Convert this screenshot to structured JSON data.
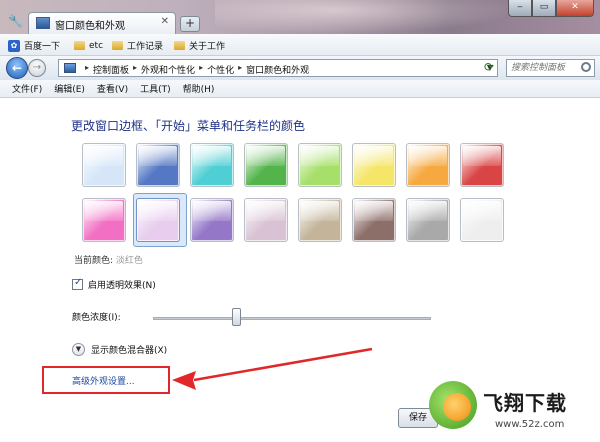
{
  "browser": {
    "tab_title": "窗口颜色和外观",
    "newtab_label": "+",
    "window_buttons": [
      "‒",
      "▭",
      "✕"
    ]
  },
  "favorites": [
    "百度一下",
    "etc",
    "工作记录",
    "关于工作"
  ],
  "address": {
    "breadcrumbs": [
      "控制面板",
      "外观和个性化",
      "个性化",
      "窗口颜色和外观"
    ],
    "search_placeholder": "搜索控制面板"
  },
  "menu": [
    "文件(F)",
    "编辑(E)",
    "查看(V)",
    "工具(T)",
    "帮助(H)"
  ],
  "main": {
    "title": "更改窗口边框、「开始」菜单和任务栏的颜色",
    "current_color_label": "当前颜色:",
    "current_color_value": "淡红色",
    "transparency_label": "启用透明效果(N)",
    "transparency_checked": true,
    "intensity_label": "颜色浓度(I):",
    "intensity_value": 0.3,
    "mixer_label": "显示颜色混合器(X)",
    "advanced_link": "高级外观设置...",
    "save_label": "保存",
    "swatches_row1": [
      "#d6e6f8",
      "#5478c4",
      "#4fcfd4",
      "#52b44a",
      "#a6df6a",
      "#f5e66a",
      "#f6a940",
      "#d94545"
    ],
    "swatches_row2": [
      "#f26fc3",
      "#e8cdee",
      "#9478c7",
      "#d8c2d4",
      "#c4b49a",
      "#8d6f6a",
      "#a9a9a9",
      "#eeeeee"
    ],
    "selected_index": 9
  },
  "watermark": {
    "name": "飞翔下载",
    "url": "www.52z.com"
  }
}
